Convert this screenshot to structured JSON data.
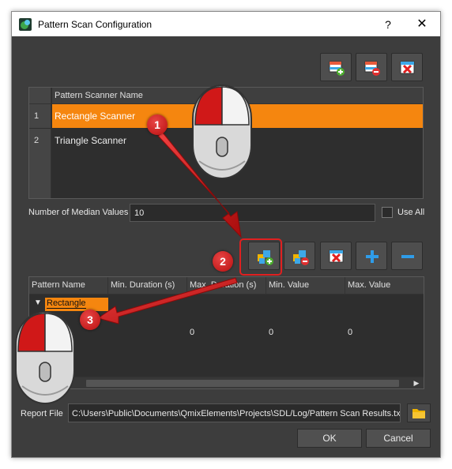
{
  "window": {
    "title": "Pattern Scan Configuration",
    "help_glyph": "?",
    "close_glyph": "✕"
  },
  "top_toolbar": [
    {
      "icon": "add-table-icon",
      "tooltip": ""
    },
    {
      "icon": "remove-table-icon",
      "tooltip": ""
    },
    {
      "icon": "clear-table-icon",
      "tooltip": ""
    }
  ],
  "scanner_table": {
    "header": "Pattern Scanner Name",
    "rows": [
      {
        "index": "1",
        "name": "Rectangle Scanner",
        "selected": true
      },
      {
        "index": "2",
        "name": "Triangle Scanner",
        "selected": false
      }
    ]
  },
  "median": {
    "label": "Number of Median Values",
    "value": "10",
    "use_all_label": "Use All",
    "use_all_checked": false
  },
  "pattern_toolbar": [
    {
      "icon": "add-pattern-icon"
    },
    {
      "icon": "remove-pattern-icon"
    },
    {
      "icon": "clear-patterns-icon"
    },
    {
      "icon": "plus-icon"
    },
    {
      "icon": "minus-icon"
    }
  ],
  "pattern_table": {
    "columns": [
      "Pattern Name",
      "Min. Duration (s)",
      "Max. Duration (s)",
      "Min. Value",
      "Max. Value"
    ],
    "group": "Rectangle",
    "row_values": [
      "0",
      "0",
      "0"
    ]
  },
  "report": {
    "label": "Report File",
    "path": "C:\\Users\\Public\\Documents\\QmixElements\\Projects\\SDL/Log/Pattern Scan Results.txt"
  },
  "buttons": {
    "ok": "OK",
    "cancel": "Cancel"
  },
  "annotations": {
    "step1": "1",
    "step2": "2",
    "step3": "3"
  },
  "colors": {
    "accent": "#f5860f",
    "dialog_bg": "#3d3d3d",
    "callout_red": "#d01818"
  }
}
